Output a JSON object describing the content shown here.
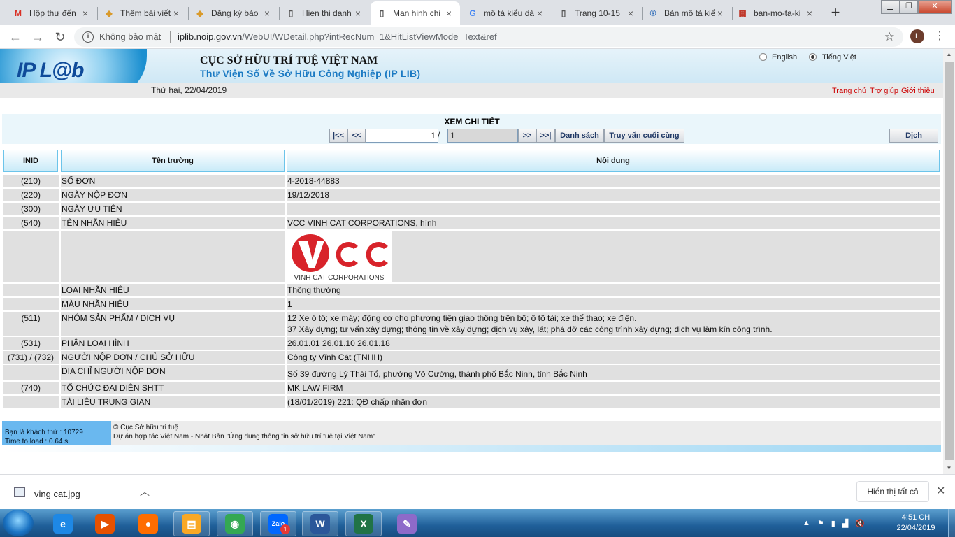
{
  "browser": {
    "tabs": [
      {
        "title": "Hộp thư đến",
        "icon": "gmail-icon",
        "glyph": "M",
        "color": "#d93025"
      },
      {
        "title": "Thêm bài viết",
        "icon": "site-icon",
        "glyph": "◆",
        "color": "#d99a2b"
      },
      {
        "title": "Đăng ký bảo hộ",
        "icon": "site-icon",
        "glyph": "◆",
        "color": "#d99a2b"
      },
      {
        "title": "Hien thi danh",
        "icon": "page-icon",
        "glyph": "▯",
        "color": "#555"
      },
      {
        "title": "Man hinh chi",
        "icon": "page-icon",
        "glyph": "▯",
        "color": "#555"
      },
      {
        "title": "mô tả kiểu dáng",
        "icon": "google-icon",
        "glyph": "G",
        "color": "#4285f4"
      },
      {
        "title": "Trang 10-15",
        "icon": "page-icon",
        "glyph": "▯",
        "color": "#555"
      },
      {
        "title": "Bản mô tả kiểu",
        "icon": "registered-icon",
        "glyph": "®",
        "color": "#1a5fb4"
      },
      {
        "title": "ban-mo-ta-ki",
        "icon": "doc-icon",
        "glyph": "▦",
        "color": "#c0392b"
      }
    ],
    "active_tab": 4,
    "security_label": "Không bảo mật",
    "url_host": "iplib.noip.gov.vn",
    "url_path": "/WebUI/WDetail.php?intRecNum=1&HitListViewMode=Text&ref=",
    "avatar_letter": "L"
  },
  "site": {
    "logo_text": "IP L@b",
    "org_name": "CỤC SỞ HỮU TRÍ TUỆ VIỆT NAM",
    "lib_name": "Thư Viện Số Về Sở Hữu Công Nghiệp (IP LIB)",
    "lang_en": "English",
    "lang_vi": "Tiếng Việt",
    "date": "Thứ hai, 22/04/2019",
    "links": {
      "home": "Trang chủ",
      "help": "Trợ giúp",
      "about": "Giới thiệu"
    }
  },
  "nav": {
    "title": "XEM CHI TIẾT",
    "first": "|<<",
    "prev": "<<",
    "record_value": "1",
    "slash": "/",
    "total_value": "1",
    "next": ">>",
    "last": ">>|",
    "list": "Danh sách",
    "last_query": "Truy vấn cuối cùng",
    "translate": "Dịch"
  },
  "table": {
    "headers": {
      "inid": "INID",
      "field": "Tên trường",
      "content": "Nội dung"
    },
    "rows": [
      {
        "inid": "(210)",
        "field": "SỐ ĐƠN",
        "value": "4-2018-44883"
      },
      {
        "inid": "(220)",
        "field": "NGÀY NỘP ĐƠN",
        "value": "19/12/2018"
      },
      {
        "inid": "(300)",
        "field": "NGÀY ƯU TIÊN",
        "value": ""
      },
      {
        "inid": "(540)",
        "field": "TÊN NHÃN HIỆU",
        "value": "VCC VINH CAT CORPORATIONS, hình"
      },
      {
        "inid": "",
        "field": "",
        "value": ""
      },
      {
        "inid": "",
        "field": "LOẠI NHÃN HIỆU",
        "value": "Thông thường"
      },
      {
        "inid": "",
        "field": "MÀU NHÃN HIỆU",
        "value": "1"
      },
      {
        "inid": "(511)",
        "field": "NHÓM SẢN PHẨM / DỊCH VỤ",
        "value": "12 Xe ô tô; xe máy; động cơ cho phương tiện giao thông trên bộ; ô tô tải; xe thể thao; xe điện.",
        "value2": "37 Xây dựng; tư vấn xây dựng; thông tin về xây dựng; dịch vụ xây, lát; phá dỡ các công trình xây dựng; dịch vụ làm kín công trình."
      },
      {
        "inid": "(531)",
        "field": "PHÂN LOẠI HÌNH",
        "value": "26.01.01 26.01.10 26.01.18"
      },
      {
        "inid": "(731) / (732)",
        "field": "NGƯỜI NỘP ĐƠN / CHỦ SỞ HỮU",
        "value": "Công ty Vĩnh Cát (TNHH)"
      },
      {
        "inid": "",
        "field": "ĐỊA CHỈ NGƯỜI NỘP ĐƠN",
        "value": "Số 39 đường Lý Thái Tổ, phường Võ Cường, thành phố Bắc Ninh, tỉnh Bắc Ninh"
      },
      {
        "inid": "(740)",
        "field": "TỔ CHỨC ĐẠI DIỆN SHTT",
        "value": "MK LAW FIRM"
      },
      {
        "inid": "",
        "field": "TÀI LIỆU TRUNG GIAN",
        "value": "(18/01/2019) 221: QĐ chấp nhận đơn"
      }
    ],
    "logo": {
      "mark": "VCC",
      "caption": "VINH CAT CORPORATIONS",
      "color": "#d8232a"
    }
  },
  "footer": {
    "counter": "Bạn là khách thứ : 10729",
    "load_time": "Time to load : 0.64 s",
    "copyright": "© Cục Sở hữu trí tuệ",
    "project": "Dự án hợp tác Việt Nam - Nhật Bản \"Ứng dụng thông tin sở hữu trí tuệ tại Việt Nam\""
  },
  "downloads": {
    "file": "ving cat.jpg",
    "show_all": "Hiển thị tất cả"
  },
  "taskbar": {
    "apps": [
      {
        "name": "ie-icon",
        "glyph": "e",
        "color": "#1e88e5"
      },
      {
        "name": "media-player-icon",
        "glyph": "▶",
        "color": "#e65100"
      },
      {
        "name": "firefox-icon",
        "glyph": "●",
        "color": "#ff6d00"
      },
      {
        "name": "file-explorer-icon",
        "glyph": "▤",
        "color": "#f9a825"
      },
      {
        "name": "chrome-icon",
        "glyph": "◉",
        "color": "#34a853"
      },
      {
        "name": "zalo-icon",
        "glyph": "Zalo",
        "color": "#0068ff"
      },
      {
        "name": "word-icon",
        "glyph": "W",
        "color": "#2b579a"
      },
      {
        "name": "excel-icon",
        "glyph": "X",
        "color": "#217346"
      },
      {
        "name": "paint-icon",
        "glyph": "✎",
        "color": "#8e6ac9"
      }
    ],
    "zalo_badge": "1",
    "time": "4:51 CH",
    "date": "22/04/2019"
  }
}
